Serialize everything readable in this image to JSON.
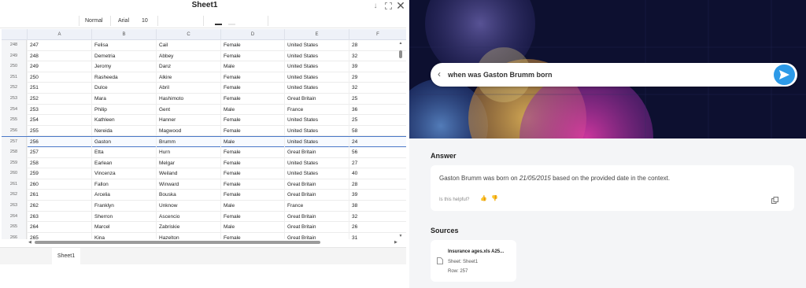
{
  "sheet": {
    "title": "Sheet1",
    "toolbar": {
      "style": "Normal",
      "font": "Arial",
      "size": "10"
    },
    "columns": [
      "A",
      "B",
      "C",
      "D",
      "E",
      "F"
    ],
    "rows": [
      {
        "n": "248",
        "cells": [
          "247",
          "Felisa",
          "Cail",
          "Female",
          "United States",
          "28"
        ]
      },
      {
        "n": "249",
        "cells": [
          "248",
          "Demetria",
          "Abbey",
          "Female",
          "United States",
          "32"
        ]
      },
      {
        "n": "250",
        "cells": [
          "249",
          "Jeromy",
          "Danz",
          "Male",
          "United States",
          "39"
        ]
      },
      {
        "n": "251",
        "cells": [
          "250",
          "Rasheeda",
          "Alkire",
          "Female",
          "United States",
          "29"
        ]
      },
      {
        "n": "252",
        "cells": [
          "251",
          "Dulce",
          "Abril",
          "Female",
          "United States",
          "32"
        ]
      },
      {
        "n": "253",
        "cells": [
          "252",
          "Mara",
          "Hashimoto",
          "Female",
          "Great Britain",
          "25"
        ]
      },
      {
        "n": "254",
        "cells": [
          "253",
          "Philip",
          "Gent",
          "Male",
          "France",
          "36"
        ]
      },
      {
        "n": "255",
        "cells": [
          "254",
          "Kathleen",
          "Hanner",
          "Female",
          "United States",
          "25"
        ]
      },
      {
        "n": "256",
        "cells": [
          "255",
          "Nereida",
          "Magwood",
          "Female",
          "United States",
          "58"
        ]
      },
      {
        "n": "257",
        "cells": [
          "256",
          "Gaston",
          "Brumm",
          "Male",
          "United States",
          "24"
        ]
      },
      {
        "n": "258",
        "cells": [
          "257",
          "Etta",
          "Hurn",
          "Female",
          "Great Britain",
          "56"
        ]
      },
      {
        "n": "259",
        "cells": [
          "258",
          "Earlean",
          "Melgar",
          "Female",
          "United States",
          "27"
        ]
      },
      {
        "n": "260",
        "cells": [
          "259",
          "Vincenza",
          "Weiland",
          "Female",
          "United States",
          "40"
        ]
      },
      {
        "n": "261",
        "cells": [
          "260",
          "Fallon",
          "Winward",
          "Female",
          "Great Britain",
          "28"
        ]
      },
      {
        "n": "262",
        "cells": [
          "261",
          "Arcelia",
          "Bouska",
          "Female",
          "Great Britain",
          "39"
        ]
      },
      {
        "n": "263",
        "cells": [
          "262",
          "Franklyn",
          "Unknow",
          "Male",
          "France",
          "38"
        ]
      },
      {
        "n": "264",
        "cells": [
          "263",
          "Sherron",
          "Ascencio",
          "Female",
          "Great Britain",
          "32"
        ]
      },
      {
        "n": "265",
        "cells": [
          "264",
          "Marcel",
          "Zabriskie",
          "Male",
          "Great Britain",
          "26"
        ]
      },
      {
        "n": "266",
        "cells": [
          "265",
          "Kina",
          "Hazelton",
          "Female",
          "Great Britain",
          "31"
        ]
      }
    ],
    "selected_row": "257",
    "tab": "Sheet1"
  },
  "chat": {
    "query": "when was Gaston  Brumm born",
    "answer_heading": "Answer",
    "answer": {
      "name": "Gaston Brumm",
      "pre": " was born on ",
      "date": "21/05/2015",
      "post": " based on the provided date in the context."
    },
    "helpful_label": "Is this helpful?",
    "sources_heading": "Sources",
    "source": {
      "file": "Insurance ages.xls A25...",
      "sheet": "Sheet: Sheet1",
      "row": "Row: 257"
    },
    "colors": {
      "accent": "#2d9ae8",
      "hero_bg": "#0d1030",
      "selection": "#4a78c8"
    }
  }
}
